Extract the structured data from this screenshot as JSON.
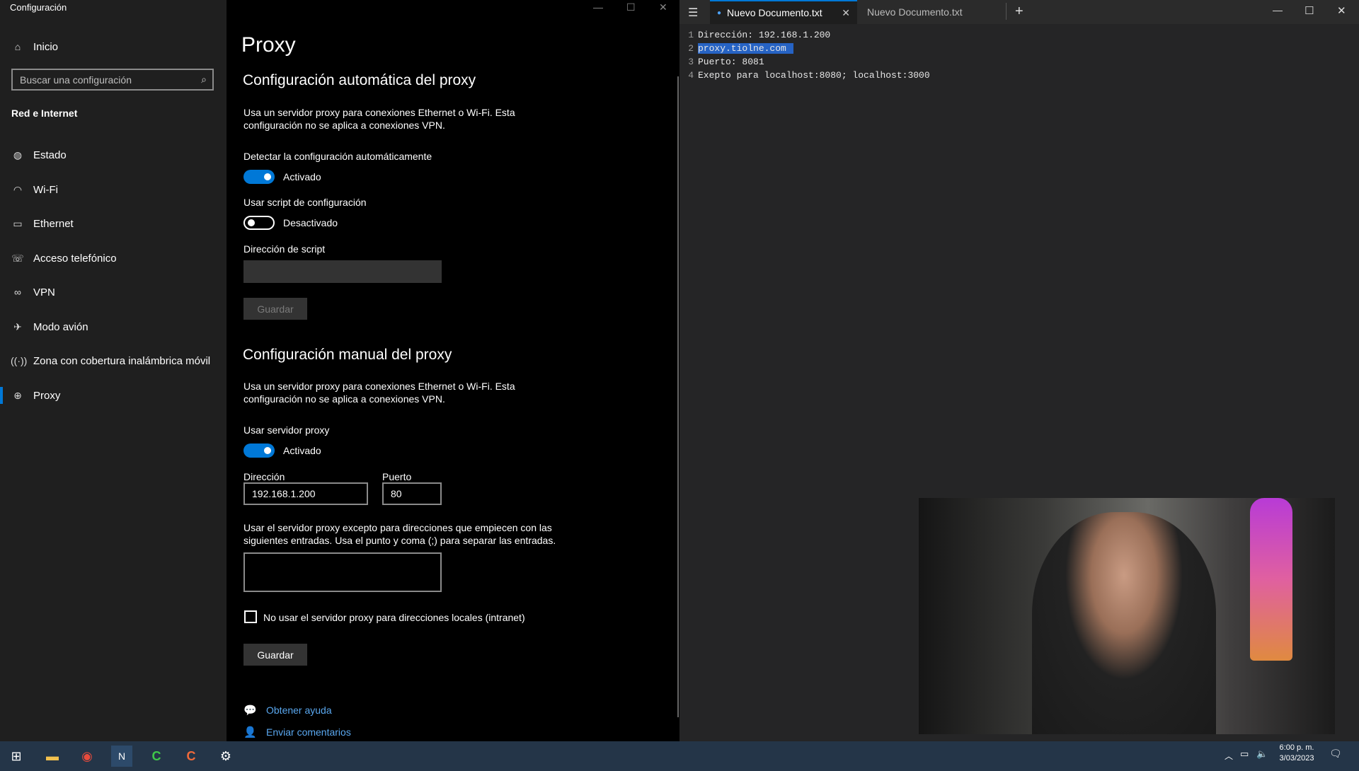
{
  "settings": {
    "window_title": "Configuración",
    "search_placeholder": "Buscar una configuración",
    "home": "Inicio",
    "section": "Red e Internet",
    "nav": [
      {
        "label": "Estado",
        "icon": "globe-status-icon"
      },
      {
        "label": "Wi-Fi",
        "icon": "wifi-icon"
      },
      {
        "label": "Ethernet",
        "icon": "ethernet-icon"
      },
      {
        "label": "Acceso telefónico",
        "icon": "dialup-icon"
      },
      {
        "label": "VPN",
        "icon": "vpn-icon"
      },
      {
        "label": "Modo avión",
        "icon": "airplane-icon"
      },
      {
        "label": "Zona con cobertura inalámbrica móvil",
        "icon": "hotspot-icon"
      },
      {
        "label": "Proxy",
        "icon": "globe-icon"
      }
    ],
    "page_title": "Proxy",
    "auto": {
      "heading": "Configuración automática del proxy",
      "desc1": "Usa un servidor proxy para conexiones Ethernet o Wi-Fi. Esta",
      "desc2": "configuración no se aplica a conexiones VPN.",
      "detect_label": "Detectar la configuración automáticamente",
      "detect_state": "Activado",
      "script_label": "Usar script de configuración",
      "script_state": "Desactivado",
      "script_address_label": "Dirección de script",
      "save": "Guardar"
    },
    "manual": {
      "heading": "Configuración manual del proxy",
      "desc1": "Usa un servidor proxy para conexiones Ethernet o Wi-Fi. Esta",
      "desc2": "configuración no se aplica a conexiones VPN.",
      "use_label": "Usar servidor proxy",
      "use_state": "Activado",
      "address_label": "Dirección",
      "address_value": "192.168.1.200",
      "port_label": "Puerto",
      "port_value": "80",
      "except1": "Usar el servidor proxy excepto para direcciones que empiecen con las",
      "except2": "siguientes entradas. Usa el punto y coma (;) para separar las entradas.",
      "local_label": "No usar el servidor proxy para direcciones locales (intranet)",
      "save": "Guardar"
    },
    "help": "Obtener ayuda",
    "feedback": "Enviar comentarios"
  },
  "notepad": {
    "tabs": [
      "Nuevo Documento.txt",
      "Nuevo Documento.txt"
    ],
    "lines": [
      {
        "n": "1",
        "text": "Dirección: 192.168.1.200"
      },
      {
        "n": "2",
        "text": "proxy.tiolne.com"
      },
      {
        "n": "3",
        "text": "Puerto: 8081"
      },
      {
        "n": "4",
        "text": "Exepto para localhost:8080; localhost:3000"
      }
    ]
  },
  "taskbar": {
    "time": "6:00 p. m.",
    "date": "3/03/2023"
  },
  "colors": {
    "accent": "#0078d7",
    "link": "#5aa8f0",
    "taskbar": "#243548"
  }
}
